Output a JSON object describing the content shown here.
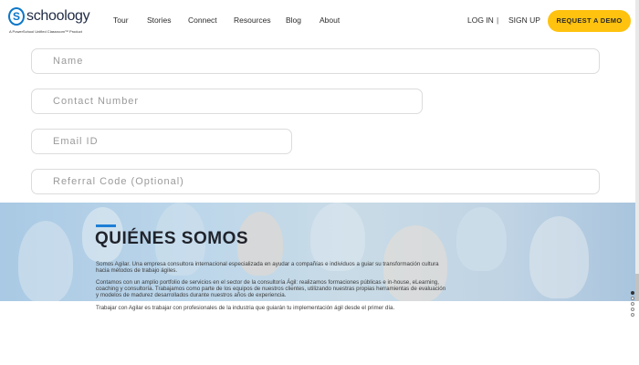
{
  "header": {
    "brand": "schoology",
    "brand_mark": "S",
    "tagline": "A PowerSchool Unified Classroom™ Product",
    "nav": [
      "Tour",
      "Stories",
      "Connect",
      "Resources",
      "Blog",
      "About"
    ],
    "login_label": "LOG IN",
    "separator": "|",
    "signup_label": "SIGN UP",
    "demo_label": "REQUEST A DEMO"
  },
  "form": {
    "name_placeholder": "Name",
    "contact_placeholder": "Contact Number",
    "email_placeholder": "Email ID",
    "referral_placeholder": "Referral Code (Optional)"
  },
  "about": {
    "title": "QUIÉNES SOMOS",
    "paragraph_1_line_1": "Somos Agilar. Una empresa consultora internacional especializada en ayudar a compañías e individuos a guiar su transformación cultura",
    "paragraph_1_line_2": "hacia métodos de trabajo ágiles.",
    "paragraph_2_line_1": "Contamos con un amplio portfolio de servicios en el sector de la consultoría Ágil: realizamos formaciones públicas e in-house, eLearning,",
    "paragraph_2_line_2": "coaching y consultoría. Trabajamos como parte de los equipos de nuestros clientes, utilizando nuestras propias herramientas de evaluación",
    "paragraph_2_line_3": "y modelos de madurez desarrollados durante nuestros años de experiencia.",
    "paragraph_3_line_1": "Trabajar con Agilar es trabajar con profesionales de la industria que guiarán tu implementación ágil desde el primer día."
  },
  "colors": {
    "accent_yellow": "#ffc20e",
    "brand_blue": "#0a77c9",
    "accent_bar": "#1e7fd6"
  },
  "slider": {
    "slide_count": 5,
    "active_index": 0
  }
}
